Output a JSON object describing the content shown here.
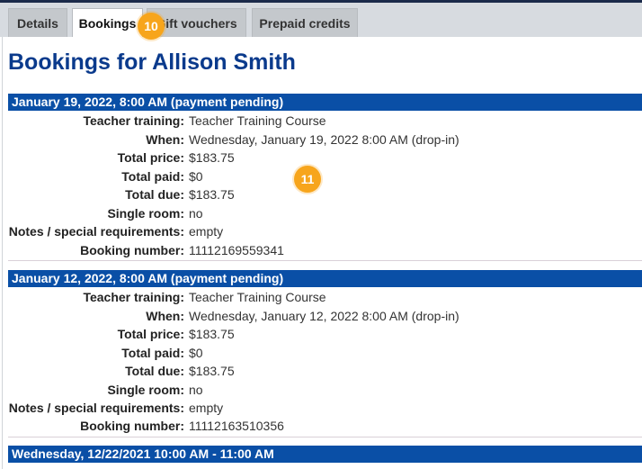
{
  "tabs": [
    {
      "label": "Details"
    },
    {
      "label": "Bookings"
    },
    {
      "label": "Gift vouchers"
    },
    {
      "label": "Prepaid credits"
    }
  ],
  "page_title": "Bookings for Allison Smith",
  "bookings": [
    {
      "header": "January 19, 2022, 8:00 AM (payment pending)",
      "rows": [
        {
          "label": "Teacher training:",
          "value": "Teacher Training Course"
        },
        {
          "label": "When:",
          "value": "Wednesday, January 19, 2022 8:00 AM (drop-in)"
        },
        {
          "label": "Total price:",
          "value": "$183.75"
        },
        {
          "label": "Total paid:",
          "value": "$0"
        },
        {
          "label": "Total due:",
          "value": "$183.75"
        },
        {
          "label": "Single room:",
          "value": "no"
        },
        {
          "label": "Notes / special requirements:",
          "value": "empty"
        },
        {
          "label": "Booking number:",
          "value": "11112169559341"
        }
      ]
    },
    {
      "header": "January 12, 2022, 8:00 AM (payment pending)",
      "rows": [
        {
          "label": "Teacher training:",
          "value": "Teacher Training Course"
        },
        {
          "label": "When:",
          "value": "Wednesday, January 12, 2022 8:00 AM (drop-in)"
        },
        {
          "label": "Total price:",
          "value": "$183.75"
        },
        {
          "label": "Total paid:",
          "value": "$0"
        },
        {
          "label": "Total due:",
          "value": "$183.75"
        },
        {
          "label": "Single room:",
          "value": "no"
        },
        {
          "label": "Notes / special requirements:",
          "value": "empty"
        },
        {
          "label": "Booking number:",
          "value": "11112163510356"
        }
      ]
    },
    {
      "header": "Wednesday, 12/22/2021 10:00 AM - 11:00 AM"
    }
  ],
  "badges": {
    "tab_badge": "10",
    "content_badge": "11"
  },
  "colors": {
    "title": "#0a3a8c",
    "header_bar": "#0a4fa6",
    "badge": "#f7a51c",
    "tab_strip": "#d7dbe0"
  }
}
